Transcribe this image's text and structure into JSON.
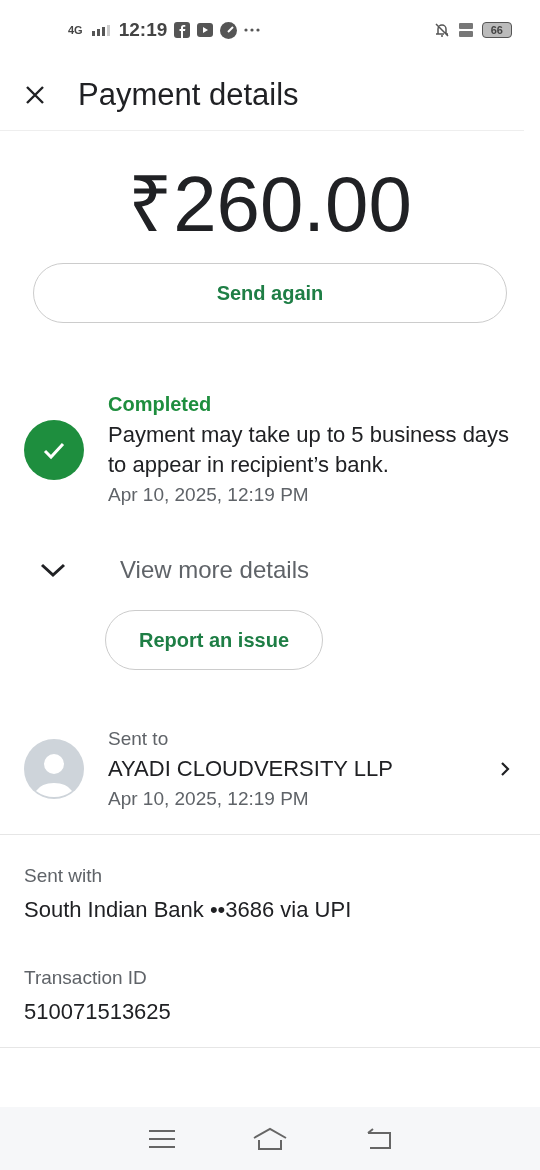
{
  "status_bar": {
    "network": "4G",
    "time": "12:19",
    "battery": "66"
  },
  "header": {
    "title": "Payment details"
  },
  "amount": "₹260.00",
  "send_again": "Send again",
  "status": {
    "kind": "completed",
    "label": "Completed",
    "message": "Payment may take up to 5 business days to appear in recipient’s bank.",
    "time": "Apr 10, 2025, 12:19 PM"
  },
  "view_more": {
    "label": "View more details",
    "expanded": false
  },
  "report": "Report an issue",
  "recipient": {
    "label": "Sent to",
    "name": "AYADI CLOUDVERSITY LLP",
    "time": "Apr 10, 2025, 12:19 PM"
  },
  "details": [
    {
      "label": "Sent with",
      "value": "South Indian Bank ••3686 via UPI"
    },
    {
      "label": "Transaction ID",
      "value": "510071513625"
    }
  ]
}
